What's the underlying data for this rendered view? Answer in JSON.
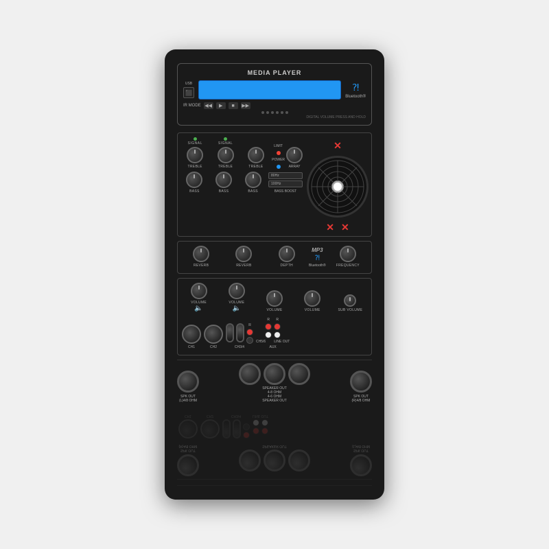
{
  "device": {
    "title": "MEDIA PLAYER",
    "bluetooth_label": "Bluetooth®",
    "usb_label": "USB",
    "ir_mode_label": "IR MODE",
    "digital_volume_label": "DIGITAL VOLUME PRESS AND HOLD",
    "lcd_text": ""
  },
  "channels": {
    "ch1_label": "CH1",
    "ch2_label": "CH2",
    "ch3_4_label": "CH3/4",
    "ch5_6_label": "CH5/6",
    "line_out_label": "LINE OUT",
    "aux_label": "AUX"
  },
  "knobs": {
    "signal_label": "SIGNAL",
    "treble_label": "TREBLE",
    "bass_label": "BASS",
    "reverb_label": "REVERB",
    "depth_label": "DEPTH",
    "volume_label": "VOLUME",
    "sub_volume_label": "SUB VOLUME",
    "frequency_label": "FREQUENCY",
    "array_label": "ARRAY",
    "limit_label": "LIMIT",
    "power_label": "POWER"
  },
  "bass_boost": {
    "hz80_label": "80Hz",
    "hz100_label": "100Hz",
    "label": "BASS BOOST"
  },
  "mp3": {
    "label": "MP3",
    "bluetooth_label": "Bluetooth®"
  },
  "spk_out": {
    "left_label": "SPK OUT\n(L)4/8 OHM",
    "right_label": "SPK OUT\n(R)4/8 OHM",
    "center_label": "SPEAKER OUT\n4-8 OHM\n4-8 OHM\nSPEAKER OUT"
  }
}
